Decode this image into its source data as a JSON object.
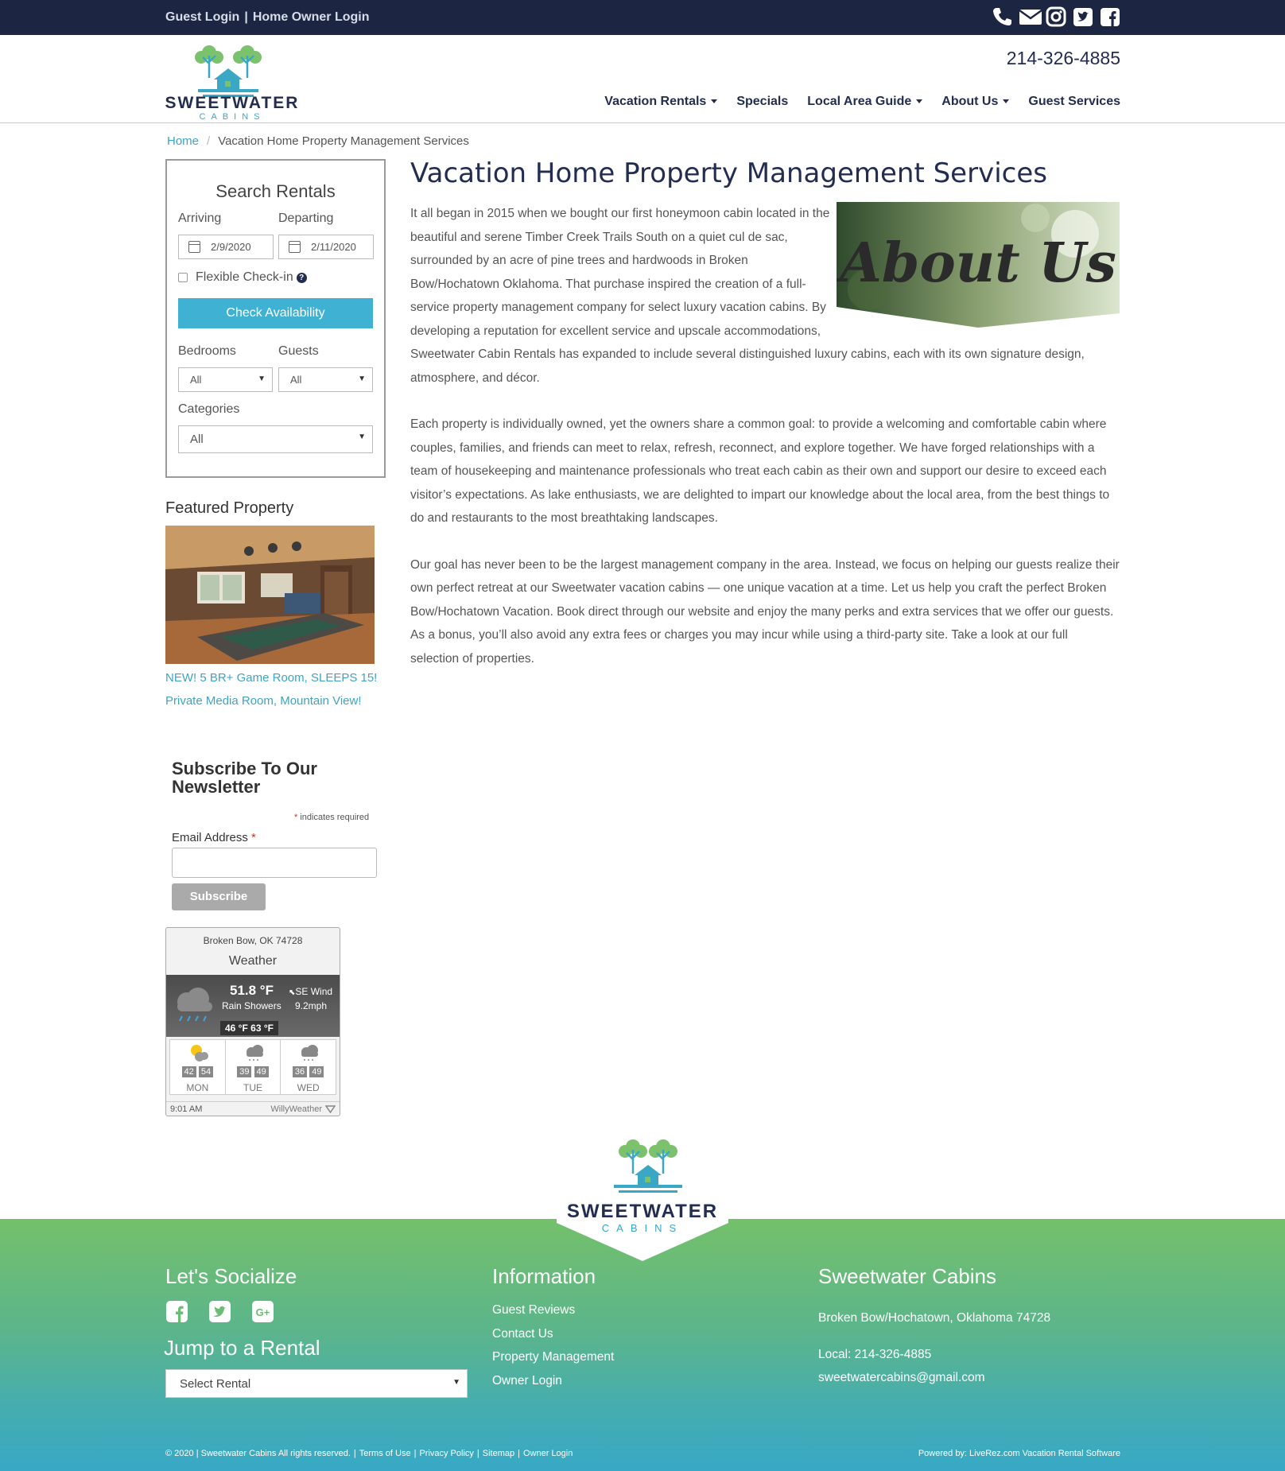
{
  "topbar": {
    "guest_login": "Guest Login",
    "separator": "|",
    "owner_login": "Home Owner Login",
    "icons": [
      "phone-icon",
      "email-icon",
      "instagram-icon",
      "twitter-icon",
      "facebook-icon"
    ]
  },
  "header": {
    "logo_text": "SWEETWATER",
    "logo_subtext": "CABINS",
    "phone": "214-326-4885",
    "nav": [
      {
        "label": "Vacation Rentals",
        "dropdown": true
      },
      {
        "label": "Specials",
        "dropdown": false
      },
      {
        "label": "Local Area Guide",
        "dropdown": true
      },
      {
        "label": "About Us",
        "dropdown": true
      },
      {
        "label": "Guest Services",
        "dropdown": false
      }
    ]
  },
  "breadcrumb": {
    "home": "Home",
    "separator": "/",
    "current": "Vacation Home Property Management Services"
  },
  "search": {
    "title": "Search Rentals",
    "arriving_label": "Arriving",
    "departing_label": "Departing",
    "arriving_value": "2/9/2020",
    "departing_value": "2/11/2020",
    "flexible_label": "Flexible Check-in",
    "check_button": "Check Availability",
    "bedrooms_label": "Bedrooms",
    "guests_label": "Guests",
    "bedrooms_value": "All",
    "guests_value": "All",
    "categories_label": "Categories",
    "categories_value": "All"
  },
  "featured": {
    "title": "Featured Property",
    "link": "NEW! 5 BR+ Game Room, SLEEPS 15! Private Media Room, Mountain View!"
  },
  "newsletter": {
    "title": "Subscribe To Our Newsletter",
    "required_star": "*",
    "required_note": " indicates required",
    "email_label": "Email Address ",
    "subscribe_button": "Subscribe"
  },
  "weather": {
    "location": "Broken Bow, OK 74728",
    "title": "Weather",
    "temperature": "51.8 °F",
    "condition": "Rain Showers",
    "wind_direction": "SE Wind",
    "wind_speed": "9.2mph",
    "min_max": "46 °F   63 °F",
    "days": [
      {
        "lo": "42",
        "hi": "54",
        "name": "MON"
      },
      {
        "lo": "39",
        "hi": "49",
        "name": "TUE"
      },
      {
        "lo": "36",
        "hi": "49",
        "name": "WED"
      }
    ],
    "time": "9:01 AM",
    "brand": "WillyWeather"
  },
  "main": {
    "title": "Vacation Home Property Management Services",
    "about_image_text": "About Us",
    "paragraphs": [
      "It all began in 2015 when we bought our first honeymoon cabin located in the beautiful and serene Timber Creek Trails South on a quiet cul de sac, surrounded by an acre of pine trees and hardwoods in Broken Bow/Hochatown Oklahoma.  That purchase inspired the creation of a full-service property management company for select luxury vacation cabins.  By developing a reputation for excellent service and upscale accommodations, Sweetwater Cabin Rentals has expanded to include several distinguished luxury cabins, each with its own signature design, atmosphere, and décor.",
      "Each property is individually owned, yet the owners share a common goal: to provide a welcoming and comfortable cabin where couples, families, and friends can meet to relax, refresh, reconnect, and explore together. We have forged relationships with a team of housekeeping and maintenance professionals who treat each cabin as their own and support our desire to exceed each visitor’s expectations.  As lake enthusiasts, we are delighted to impart our knowledge about the local area, from the best things to do and restaurants to the most breathtaking landscapes.",
      "Our goal has never been to be the largest management company in the area. Instead, we focus on helping our guests realize their own perfect retreat at our Sweetwater vacation cabins — one unique vacation at a time.  Let us help you craft the perfect Broken Bow/Hochatown Vacation.  Book direct through our website and enjoy the many perks and extra services that we offer our guests. As a bonus, you’ll also avoid any extra fees or charges you may incur while using a third-party site.  Take a look at our full selection of properties."
    ]
  },
  "footer": {
    "logo_text": "SWEETWATER",
    "logo_subtext": "CABINS",
    "socialize_title": "Let's Socialize",
    "social_icons": [
      "facebook-icon",
      "twitter-icon",
      "google-plus-icon"
    ],
    "jump_title": "Jump to a Rental",
    "rental_select": "Select Rental",
    "info_title": "Information",
    "info_links": [
      "Guest Reviews",
      "Contact Us",
      "Property Management",
      "Owner Login"
    ],
    "company_title": "Sweetwater Cabins",
    "address": "Broken Bow/Hochatown, Oklahoma 74728",
    "local_phone": "Local: 214-326-4885",
    "email": "sweetwatercabins@gmail.com",
    "copyright": "© 2020 | Sweetwater Cabins All rights reserved.",
    "bottom_links": [
      "Terms of Use",
      "Privacy Policy",
      "Sitemap",
      "Owner Login"
    ],
    "powered_by": "Powered by: LiveRez.com Vacation Rental Software"
  },
  "colors": {
    "navy": "#1c2542",
    "accent_blue": "#3fb1d2",
    "link_blue": "#3fa3c4",
    "footer_green": "#74c06a",
    "footer_teal": "#38a8c6"
  }
}
